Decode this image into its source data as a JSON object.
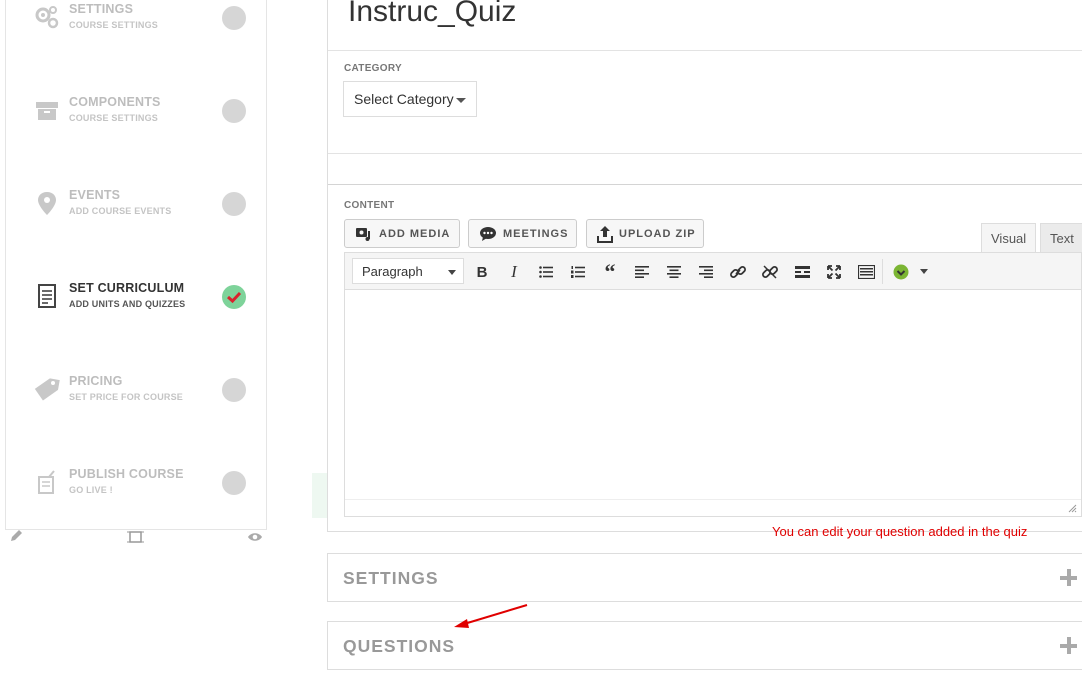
{
  "sidebar": {
    "steps": [
      {
        "title": "SETTINGS",
        "subtitle": "COURSE SETTINGS",
        "icon": "gears-icon",
        "done": false
      },
      {
        "title": "COMPONENTS",
        "subtitle": "COURSE SETTINGS",
        "icon": "archive-icon",
        "done": false
      },
      {
        "title": "EVENTS",
        "subtitle": "ADD COURSE EVENTS",
        "icon": "map-pin-icon",
        "done": false
      },
      {
        "title": "SET CURRICULUM",
        "subtitle": "ADD UNITS AND QUIZZES",
        "icon": "document-icon",
        "done": true
      },
      {
        "title": "PRICING",
        "subtitle": "SET PRICE FOR COURSE",
        "icon": "price-tag-icon",
        "done": false
      },
      {
        "title": "PUBLISH COURSE",
        "subtitle": "GO LIVE !",
        "icon": "publish-icon",
        "done": false
      }
    ],
    "tools": [
      "pencil-icon",
      "resize-icon",
      "eye-icon"
    ]
  },
  "main": {
    "title": "Instruc_Quiz",
    "category_label": "CATEGORY",
    "category_select": "Select Category",
    "content_label": "CONTENT",
    "media_buttons": [
      "ADD MEDIA",
      "MEETINGS",
      "UPLOAD ZIP"
    ],
    "tabs": [
      "Visual",
      "Text"
    ],
    "format_select": "Paragraph",
    "toolbar_icons": [
      "bold-icon",
      "italic-icon",
      "bullet-list-icon",
      "numbered-list-icon",
      "blockquote-icon",
      "align-left-icon",
      "align-center-icon",
      "align-right-icon",
      "link-icon",
      "unlink-icon",
      "read-more-icon",
      "fullscreen-icon",
      "toolbar-toggle-icon",
      "plugin-icon"
    ],
    "accordions": [
      "SETTINGS",
      "QUESTIONS"
    ]
  },
  "annotation": "You can edit your question added in the quiz",
  "colors": {
    "accent_red": "#e00000",
    "done_green": "#7ed39a",
    "check_red": "#d9232d"
  }
}
